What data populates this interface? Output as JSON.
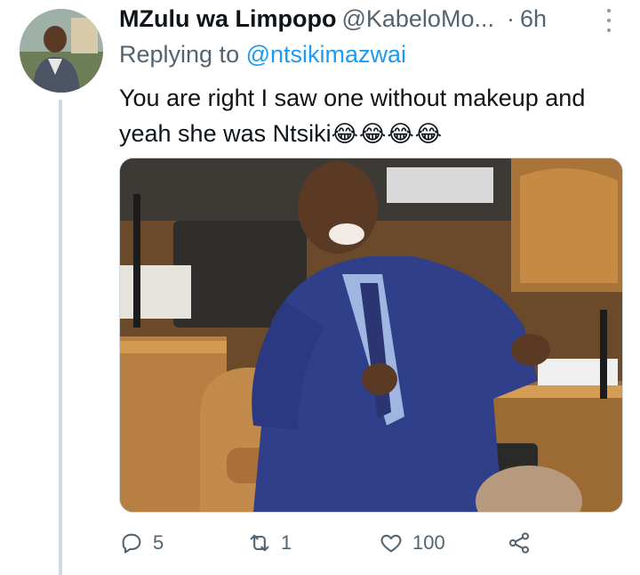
{
  "tweet": {
    "display_name": "MZulu wa Limpopo",
    "handle": "@KabeloMo...",
    "separator": "·",
    "time": "6h",
    "replying_label": "Replying to",
    "replying_to": "@ntsikimazwai",
    "text": "You are right I saw one without makeup and yeah she was Ntsiki",
    "emojis": "😂😂😂😂"
  },
  "actions": {
    "reply_count": "5",
    "retweet_count": "1",
    "like_count": "100"
  },
  "icons": {
    "reply": "reply-icon",
    "retweet": "retweet-icon",
    "like": "heart-icon",
    "share": "share-icon",
    "more": "more-icon"
  },
  "colors": {
    "text": "#0f1419",
    "secondary": "#536471",
    "link": "#1d9bf0",
    "thread_line": "#cfd9de"
  }
}
